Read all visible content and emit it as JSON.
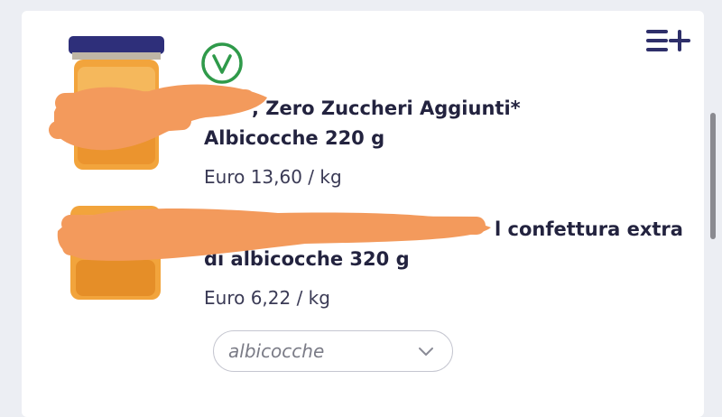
{
  "products": [
    {
      "title_line1": ", Zero Zuccheri Aggiunti*",
      "title_line2": "Albicocche 220 g",
      "price": "Euro 13,60 / kg",
      "badge_icon": "check-circle-icon",
      "image_icon": "jam-jar-icon"
    },
    {
      "title_line1": "l confettura extra",
      "title_line2": "di albicocche 320 g",
      "price": "Euro 6,22 / kg",
      "image_icon": "jam-jar-icon"
    }
  ],
  "filter": {
    "selected": "albicocche"
  },
  "header": {
    "menu_icon": "add-to-list-icon"
  },
  "colors": {
    "accent_green": "#2f9a4a",
    "redaction": "#f39a5c",
    "text": "#23233f",
    "lid": "#2e2f7a"
  }
}
